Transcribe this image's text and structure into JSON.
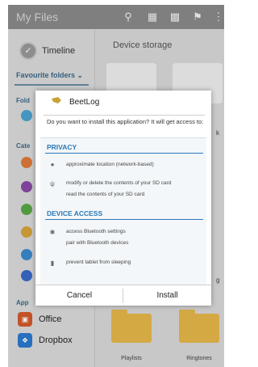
{
  "actionbar": {
    "title": "My Files",
    "icons": [
      "search-icon",
      "storage-icon",
      "grid-view-icon",
      "share-icon",
      "more-icon"
    ]
  },
  "sidebar": {
    "timeline": "Timeline",
    "favourite_folders": "Favourite folders",
    "cut_folders": "Fold",
    "cut_categories": "Cate",
    "cut_apps": "App",
    "apps": [
      {
        "label": "Office"
      },
      {
        "label": "Dropbox"
      }
    ]
  },
  "main": {
    "section_title": "Device storage",
    "cut_label_1": "k",
    "cut_label_2": "g",
    "folders": [
      {
        "label": "Playlists"
      },
      {
        "label": "Ringtones"
      }
    ]
  },
  "dialog": {
    "app_name": "BeetLog",
    "question": "Do you want to install this application? It will get access to:",
    "sections": [
      {
        "title": "PRIVACY",
        "permissions": [
          {
            "icon": "location-pin-icon",
            "text": "approximate location (network-based)"
          },
          {
            "icon": "usb-icon",
            "text": "modify or delete the contents of your SD card"
          },
          {
            "icon": "",
            "text": "read the contents of your SD card"
          }
        ]
      },
      {
        "title": "DEVICE ACCESS",
        "permissions": [
          {
            "icon": "bluetooth-icon",
            "text": "access Bluetooth settings"
          },
          {
            "icon": "",
            "text": "pair with Bluetooth devices"
          },
          {
            "icon": "lock-icon",
            "text": "prevent tablet from sleeping"
          }
        ]
      }
    ],
    "cancel_label": "Cancel",
    "install_label": "Install"
  },
  "colors": {
    "accent": "#2a78b8",
    "actionbar": "#8a8a8a",
    "folder": "#e6b84a"
  }
}
